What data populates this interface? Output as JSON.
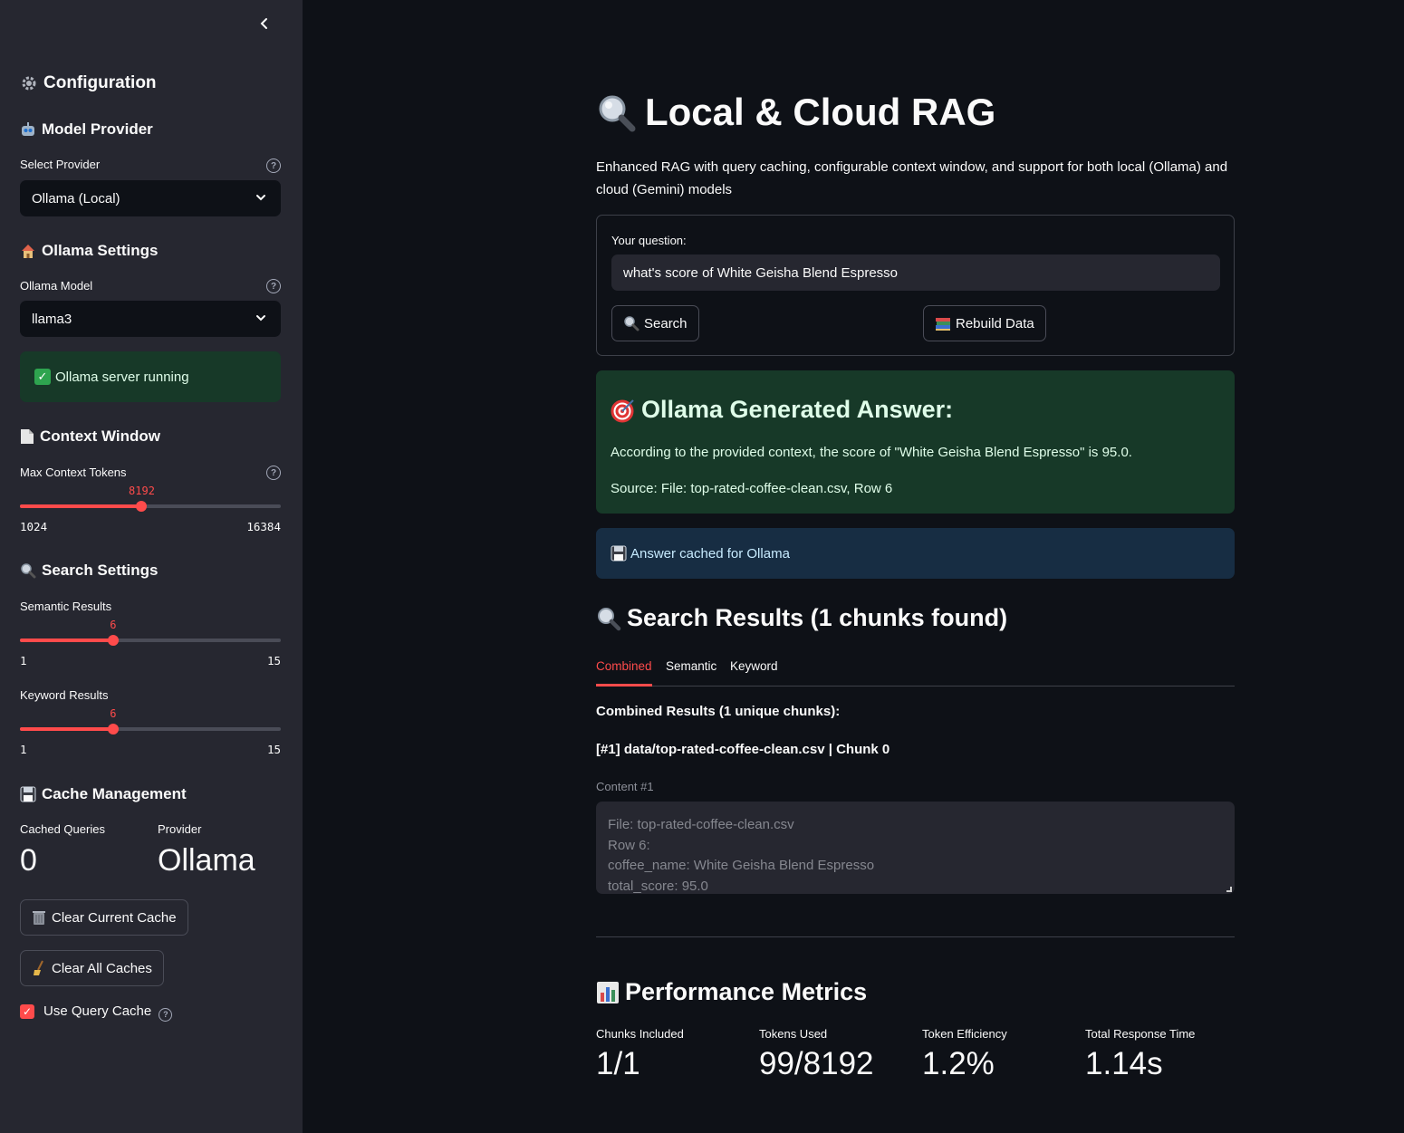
{
  "sidebar": {
    "configuration_title": "Configuration",
    "model_provider_title": "Model Provider",
    "select_provider_label": "Select Provider",
    "select_provider_value": "Ollama (Local)",
    "ollama_settings_title": "Ollama Settings",
    "ollama_model_label": "Ollama Model",
    "ollama_model_value": "llama3",
    "server_status": "Ollama server running",
    "context_window_title": "Context Window",
    "max_tokens_label": "Max Context Tokens",
    "max_tokens_value": "8192",
    "max_tokens_min": "1024",
    "max_tokens_max": "16384",
    "search_settings_title": "Search Settings",
    "semantic_label": "Semantic Results",
    "semantic_value": "6",
    "semantic_min": "1",
    "semantic_max": "15",
    "keyword_label": "Keyword Results",
    "keyword_value": "6",
    "keyword_min": "1",
    "keyword_max": "15",
    "cache_title": "Cache Management",
    "cached_queries_label": "Cached Queries",
    "cached_queries_value": "0",
    "provider_label": "Provider",
    "provider_value": "Ollama",
    "clear_current_label": "Clear Current Cache",
    "clear_all_label": "Clear All Caches",
    "use_cache_label": "Use Query Cache",
    "use_cache_checked": true
  },
  "main": {
    "title": "Local & Cloud RAG",
    "subtitle": "Enhanced RAG with query caching, configurable context window, and support for both local (Ollama) and cloud (Gemini) models",
    "question_label": "Your question:",
    "question_value": "what's score of White Geisha Blend Espresso",
    "search_button": "Search",
    "rebuild_button": "Rebuild Data",
    "answer_title": "Ollama Generated Answer:",
    "answer_text": "According to the provided context, the score of \"White Geisha Blend Espresso\" is 95.0.",
    "answer_source": "Source: File: top-rated-coffee-clean.csv, Row 6",
    "cache_info": "Answer cached for Ollama",
    "results_title": "Search Results (1 chunks found)",
    "tabs": [
      "Combined",
      "Semantic",
      "Keyword"
    ],
    "combined_header": "Combined Results (1 unique chunks):",
    "chunk_header": "[#1] data/top-rated-coffee-clean.csv | Chunk 0",
    "content_label": "Content #1",
    "content_lines": [
      "File: top-rated-coffee-clean.csv",
      "Row 6:",
      "coffee_name: White Geisha Blend Espresso",
      "total_score: 95.0"
    ],
    "metrics_title": "Performance Metrics",
    "metrics": [
      {
        "label": "Chunks Included",
        "value": "1/1"
      },
      {
        "label": "Tokens Used",
        "value": "99/8192"
      },
      {
        "label": "Token Efficiency",
        "value": "1.2%"
      },
      {
        "label": "Total Response Time",
        "value": "1.14s"
      }
    ]
  },
  "colors": {
    "accent": "#ff4b4b",
    "success_bg": "#173928",
    "info_bg": "#172d43",
    "sidebar_bg": "#262730",
    "app_bg": "#0e1117"
  },
  "sliders": {
    "max_tokens_fraction": 0.467,
    "semantic_fraction": 0.357,
    "keyword_fraction": 0.357
  }
}
